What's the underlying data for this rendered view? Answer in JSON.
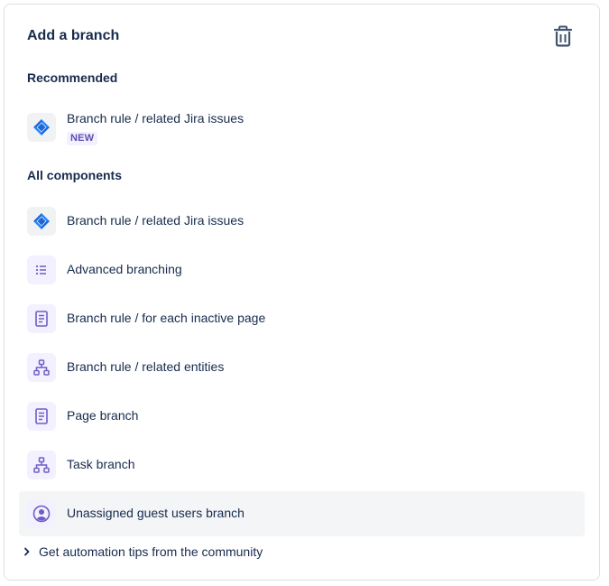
{
  "header": {
    "title": "Add a branch",
    "delete_icon": "trash-icon"
  },
  "recommended": {
    "title": "Recommended",
    "items": [
      {
        "label": "Branch rule / related Jira issues",
        "badge": "NEW",
        "icon": "jira-icon"
      }
    ]
  },
  "all_components": {
    "title": "All components",
    "items": [
      {
        "label": "Branch rule / related Jira issues",
        "icon": "jira-icon"
      },
      {
        "label": "Advanced branching",
        "icon": "list-icon"
      },
      {
        "label": "Branch rule / for each inactive page",
        "icon": "page-icon"
      },
      {
        "label": "Branch rule / related entities",
        "icon": "hierarchy-icon"
      },
      {
        "label": "Page branch",
        "icon": "page-icon"
      },
      {
        "label": "Task branch",
        "icon": "hierarchy-icon"
      },
      {
        "label": "Unassigned guest users branch",
        "icon": "user-circle-icon"
      }
    ]
  },
  "footer": {
    "tips_label": "Get automation tips from the community",
    "chevron": "chevron-right-icon"
  },
  "colors": {
    "accent_purple": "#6e5dc6",
    "jira_blue": "#1868db",
    "hover_bg": "#f4f5f7"
  }
}
